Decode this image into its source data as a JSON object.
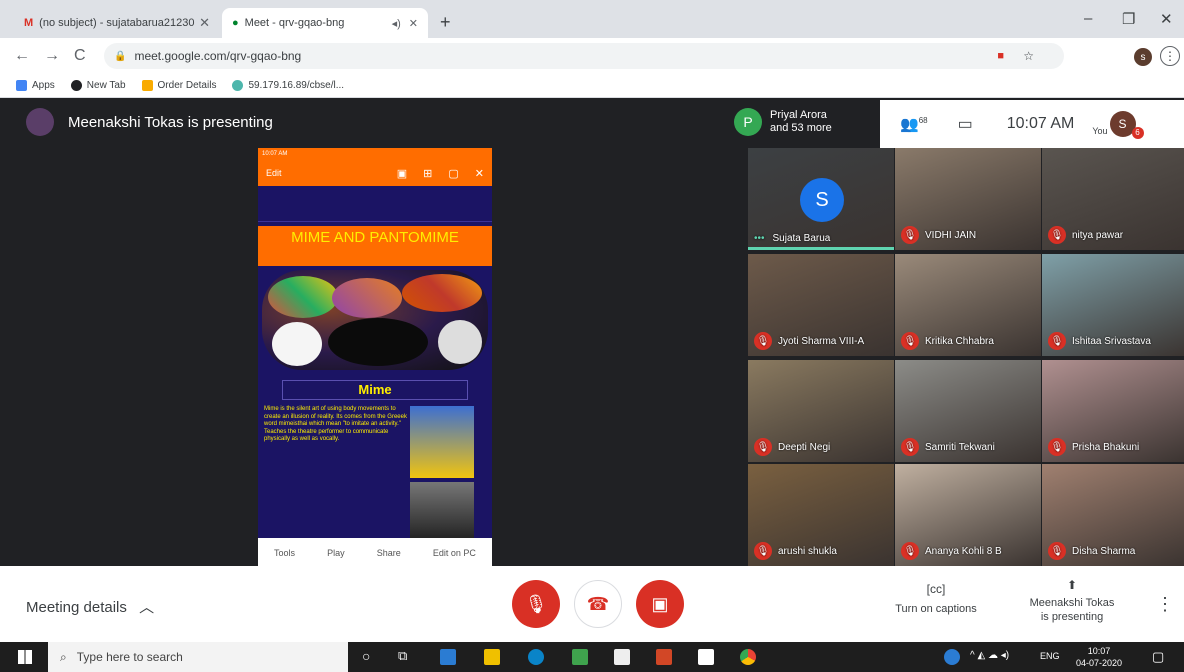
{
  "browser": {
    "tabs": [
      {
        "label": "(no subject) - sujatabarua21230"
      },
      {
        "label": "Meet - qrv-gqao-bng"
      }
    ],
    "url": "meet.google.com/qrv-gqao-bng",
    "bookmarks": [
      "Apps",
      "New Tab",
      "Order Details",
      "59.179.16.89/cbse/l..."
    ],
    "profile_initial": "s"
  },
  "meet": {
    "presenting_banner": "Meenakshi Tokas is presenting",
    "people_chip": {
      "initial": "P",
      "line1": "Priyal Arora",
      "line2": "and 53 more"
    },
    "participant_count": "68",
    "time": "10:07 AM",
    "you_label": "You",
    "self_initial": "S",
    "badge": "6"
  },
  "slide": {
    "status": "10:07 AM",
    "edit_label": "Edit",
    "title": "MIME AND PANTOMIME",
    "heading": "Mime",
    "body": "Mime is the silent art of using body movements to create an illusion of reality. Its comes from the Greeek word mimeisthai which mean \"to imitate an activity.\" Teaches the theatre performer to communicate physically as well as vocally.",
    "nav": [
      "Tools",
      "Play",
      "Share",
      "Edit on PC"
    ]
  },
  "participants": [
    {
      "name": "Sujata Barua",
      "initial": "S",
      "muted": false,
      "color": "#3c4043"
    },
    {
      "name": "VIDHI JAIN",
      "muted": true,
      "color": "#8a7a6a"
    },
    {
      "name": "nitya pawar",
      "muted": true,
      "color": "#5a5550"
    },
    {
      "name": "Jyoti Sharma VIII-A",
      "muted": true,
      "color": "#6d5a4a"
    },
    {
      "name": "Kritika Chhabra",
      "muted": true,
      "color": "#9a8a7a"
    },
    {
      "name": "Ishitaa Srivastava",
      "muted": true,
      "color": "#7fa0a8"
    },
    {
      "name": "Deepti Negi",
      "muted": true,
      "color": "#8a7a60"
    },
    {
      "name": "Samriti Tekwani",
      "muted": true,
      "color": "#8c8c88"
    },
    {
      "name": "Prisha Bhakuni",
      "muted": true,
      "color": "#b09090"
    },
    {
      "name": "arushi shukla",
      "muted": true,
      "color": "#7a6040"
    },
    {
      "name": "Ananya Kohli 8 B",
      "muted": true,
      "color": "#c0b0a0"
    },
    {
      "name": "Disha Sharma",
      "muted": true,
      "color": "#a08070"
    }
  ],
  "controls": {
    "meeting_details": "Meeting details",
    "captions": "Turn on captions",
    "presenting_line1": "Meenakshi Tokas",
    "presenting_line2": "is presenting"
  },
  "taskbar": {
    "search_placeholder": "Type here to search",
    "lang": "ENG",
    "time": "10:07",
    "date": "04-07-2020"
  }
}
